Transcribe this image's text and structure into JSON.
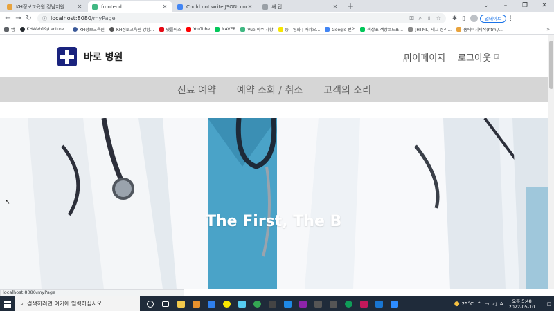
{
  "browser": {
    "tabs": [
      {
        "title": "KH정보교육원 강남지원",
        "fav_color": "#e8a33d",
        "active": false
      },
      {
        "title": "frontend",
        "fav_color": "#41b883",
        "active": true
      },
      {
        "title": "Could not write JSON: could no",
        "fav_color": "#4285f4",
        "active": false
      },
      {
        "title": "새 탭",
        "fav_color": "#9aa0a6",
        "active": false
      }
    ],
    "new_tab_glyph": "+",
    "address": {
      "host": "localhost:8080",
      "path": "/myPage"
    },
    "update_label": "업데이트",
    "bookmarks": [
      {
        "label": "앱",
        "color": "#5f6368"
      },
      {
        "label": "KHWeb19/Lecture...",
        "color": "#24292e"
      },
      {
        "label": "KH정보교육원",
        "color": "#3b5998"
      },
      {
        "label": "KH정보교육원 강남...",
        "color": "#555"
      },
      {
        "label": "넷플릭스",
        "color": "#e50914"
      },
      {
        "label": "YouTube",
        "color": "#ff0000"
      },
      {
        "label": "NAVER",
        "color": "#03c75a"
      },
      {
        "label": "Vue 이수 사항",
        "color": "#41b883"
      },
      {
        "label": "등 - 영화 | 카카오...",
        "color": "#f7e600"
      },
      {
        "label": "Google 번역",
        "color": "#4285f4"
      },
      {
        "label": "색상표 색상코드표...",
        "color": "#03c75a"
      },
      {
        "label": "[HTML] 태그 정리...",
        "color": "#888"
      },
      {
        "label": "홈페이지제작(html/...",
        "color": "#e8a33d"
      }
    ]
  },
  "site": {
    "brand": "바로 병원",
    "top_nav": {
      "my_page": "마이페이지",
      "logout": "로그아웃"
    },
    "menu": [
      "진료 예약",
      "예약 조회 / 취소",
      "고객의 소리"
    ],
    "hero_text": "The First, The Best"
  },
  "status_url": "localhost:8080/myPage",
  "taskbar": {
    "search_placeholder": "검색하려면 여기에 입력하십시오.",
    "apps": [
      "#f2c94c",
      "#e8912d",
      "#2f80ed",
      "#f2994a",
      "#56ccf2",
      "#34a853",
      "#444",
      "#1e88e5",
      "#8e24aa",
      "#555",
      "#555",
      "#0f9d58",
      "#c2185b",
      "#1976d2"
    ],
    "weather": "25°C",
    "time": "오후 5:48",
    "date": "2022-05-10",
    "lang": "A"
  }
}
